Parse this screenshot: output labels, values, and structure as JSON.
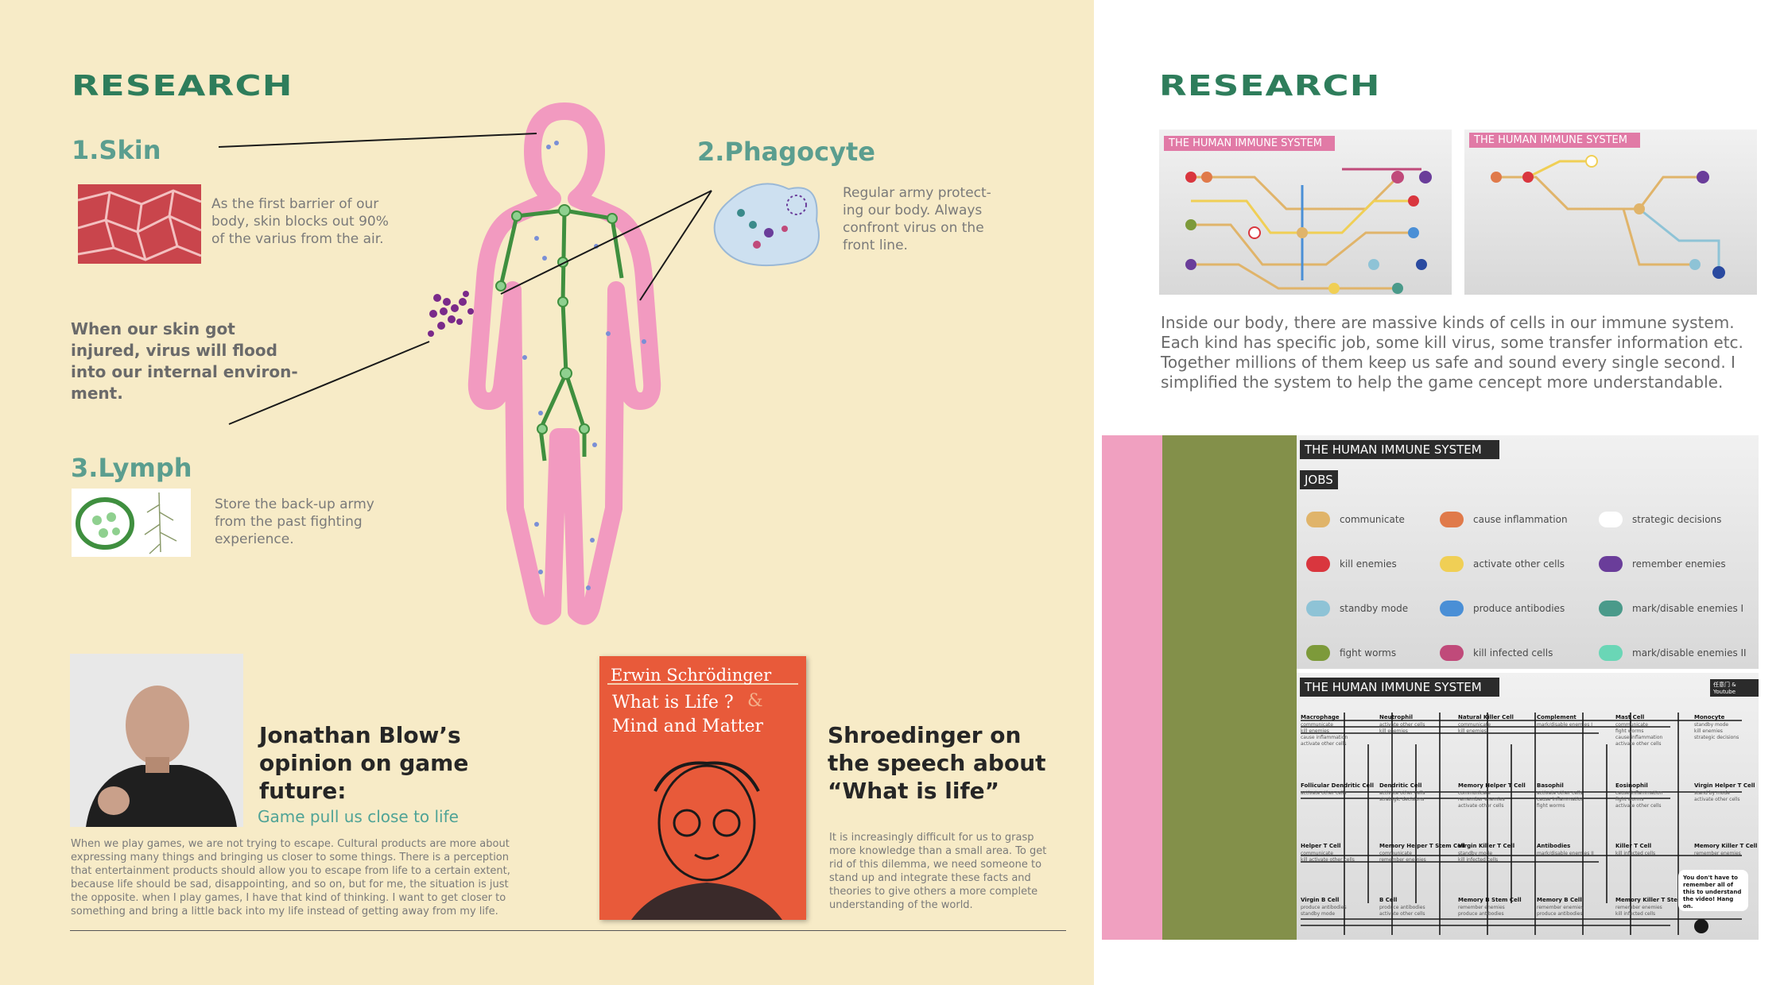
{
  "left": {
    "brand": "RESEARCH",
    "skin": {
      "title": "1.Skin",
      "desc": [
        "As the first barrier of our",
        "body, skin blocks out 90%",
        "of the varius from the air."
      ]
    },
    "phagocyte": {
      "title": "2.Phagocyte",
      "desc": [
        "Regular army protect-",
        "ing our body. Always",
        "confront virus on the",
        "front line."
      ]
    },
    "lymph": {
      "title": "3.Lymph",
      "desc": [
        "Store the back-up army",
        "from the past fighting",
        "experience."
      ]
    },
    "injury": [
      "When our skin got",
      "injured, virus will flood",
      "into our internal environ-",
      "ment."
    ],
    "blow": {
      "title": [
        "Jonathan Blow’s",
        "opinion on game",
        "future:"
      ],
      "subtitle": "Game pull us close to life",
      "body": [
        "When we play games, we are not trying to escape. Cultural products are more about",
        "expressing many things and bringing us closer to some things. There is a perception",
        "that entertainment products should allow you to escape from life to a certain extent,",
        "because life should be sad, disappointing, and so on, but for me, the situation is just",
        "the opposite. when I play games, I have that kind of thinking. I want to get closer to",
        "something and bring a little back into my life instead of getting away from my life."
      ]
    },
    "book": {
      "author": "Erwin Schrödinger",
      "line1": "What is Life ?",
      "amp": "&",
      "line2": "Mind and Matter"
    },
    "schrodinger": {
      "title": [
        "Shroedinger on",
        "the speech about",
        "“What is life”"
      ],
      "body": [
        "It is increasingly difficult for us to grasp",
        "more knowledge than a small area. To get",
        "rid of this dilemma, we need someone to",
        "stand up and integrate these facts and",
        "theories to give others a more complete",
        "understanding of the world."
      ]
    }
  },
  "right": {
    "brand": "RESEARCH",
    "shot1_label": "THE HUMAN IMMUNE SYSTEM",
    "shot2_label": "THE HUMAN IMMUNE SYSTEM",
    "paragraph": [
      "Inside our body, there are massive kinds of cells in our immune system.",
      "Each kind has specific job, some kill virus, some transfer information etc.",
      "Together millions of them keep us safe and sound every single second. I",
      "simplified the system to help the game cencept more understandable."
    ],
    "jobs_title": "THE HUMAN IMMUNE SYSTEM",
    "jobs_label": "JOBS",
    "jobs": [
      {
        "label": "communicate",
        "color": "#e0b46a"
      },
      {
        "label": "cause inflammation",
        "color": "#e07a4a"
      },
      {
        "label": "strategic decisions",
        "color": "#ffffff"
      },
      {
        "label": "kill enemies",
        "color": "#d9363e"
      },
      {
        "label": "activate other cells",
        "color": "#f0cf55"
      },
      {
        "label": "remember enemies",
        "color": "#6a3d9a"
      },
      {
        "label": "standby mode",
        "color": "#8ec3d6"
      },
      {
        "label": "produce antibodies",
        "color": "#4a8fd6"
      },
      {
        "label": "mark/disable enemies I",
        "color": "#4a9a8a"
      },
      {
        "label": "fight worms",
        "color": "#7d9a3a"
      },
      {
        "label": "kill infected cells",
        "color": "#c04a7a"
      },
      {
        "label": "mark/disable enemies II",
        "color": "#6ad6b6"
      }
    ],
    "cells_title": "THE HUMAN IMMUNE SYSTEM",
    "cells_badge": "任意门 & Youtube",
    "cells": [
      {
        "name": "Macrophage",
        "roles": [
          "communicate",
          "kill enemies",
          "cause inflammation",
          "activate other cells"
        ]
      },
      {
        "name": "Neutrophil",
        "roles": [
          "activate other cells",
          "kill enemies"
        ]
      },
      {
        "name": "Natural Killer Cell",
        "roles": [
          "communicate",
          "kill enemies"
        ]
      },
      {
        "name": "Complement",
        "roles": [
          "mark/disable enemies I"
        ]
      },
      {
        "name": "Mast Cell",
        "roles": [
          "communicate",
          "fight worms",
          "cause inflammation",
          "activate other cells"
        ]
      },
      {
        "name": "Monocyte",
        "roles": [
          "standby mode",
          "kill enemies",
          "strategic decisions"
        ]
      },
      {
        "name": "Follicular Dendritic Cell",
        "roles": [
          "activate other cells"
        ]
      },
      {
        "name": "Dendritic Cell",
        "roles": [
          "activate other cells",
          "strategic decisions"
        ]
      },
      {
        "name": "Memory Helper T Cell",
        "roles": [
          "communicate",
          "remember enemies",
          "activate other cells"
        ]
      },
      {
        "name": "Basophil",
        "roles": [
          "activate other cells",
          "cause inflammation",
          "fight worms"
        ]
      },
      {
        "name": "Eosinophil",
        "roles": [
          "cause inflammation",
          "fight worms",
          "activate other cells"
        ]
      },
      {
        "name": "Virgin Helper T Cell",
        "roles": [
          "stand by mode",
          "activate other cells"
        ]
      },
      {
        "name": "Helper T Cell",
        "roles": [
          "communicate",
          "kill activate other cells"
        ]
      },
      {
        "name": "Memory Helper T Stem Cell",
        "roles": [
          "communicate",
          "remember enemies"
        ]
      },
      {
        "name": "Virgin Killer T Cell",
        "roles": [
          "standby mode",
          "kill infected cells"
        ]
      },
      {
        "name": "Antibodies",
        "roles": [
          "mark/disable enemies II"
        ]
      },
      {
        "name": "Killer T Cell",
        "roles": [
          "kill infected cells"
        ]
      },
      {
        "name": "Memory Killer T Cell",
        "roles": [
          "remember enemies"
        ]
      },
      {
        "name": "Virgin B Cell",
        "roles": [
          "produce antibodies",
          "standby mode"
        ]
      },
      {
        "name": "B Cell",
        "roles": [
          "produce antibodies",
          "activate other cells"
        ]
      },
      {
        "name": "Memory B Stem Cell",
        "roles": [
          "remember enemies",
          "produce antibodies"
        ]
      },
      {
        "name": "Memory B Cell",
        "roles": [
          "remember enemies",
          "produce antibodies"
        ]
      },
      {
        "name": "Memory Killer T Stemm Cell",
        "roles": [
          "remember enemies",
          "kill infected cells"
        ]
      }
    ],
    "bubble": [
      "You don't have to",
      "remember all of",
      "this to understand",
      "the video! Hang on."
    ]
  },
  "colors": {
    "background_left": "#f7ebc7",
    "brand": "#2e7d5b",
    "teal": "#5b9e8f",
    "pink": "#f0a0c0",
    "olive": "#83904a",
    "body_outline": "#f29ac0",
    "lymph_green": "#3f8f3f"
  }
}
